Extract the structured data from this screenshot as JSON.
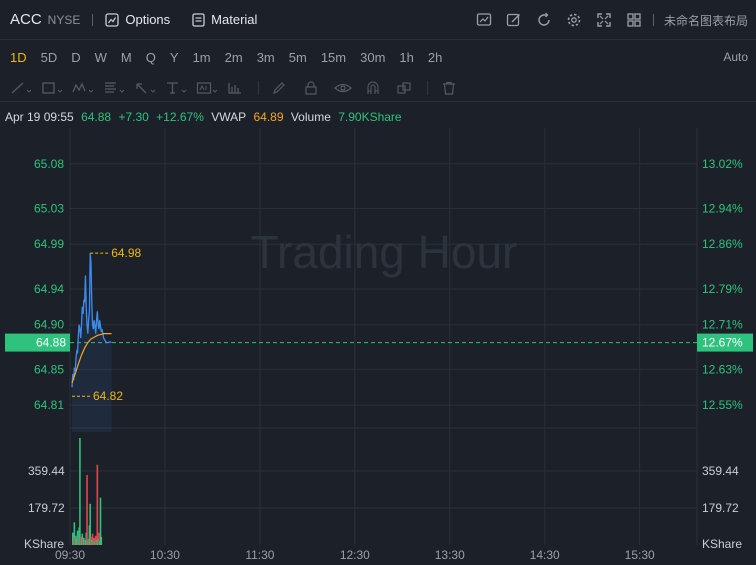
{
  "header": {
    "ticker": "ACC",
    "exchange": "NYSE",
    "options_label": "Options",
    "material_label": "Material",
    "layout_label": "未命名图表布局"
  },
  "periods": [
    "1D",
    "5D",
    "D",
    "W",
    "M",
    "Q",
    "Y",
    "1m",
    "2m",
    "3m",
    "5m",
    "15m",
    "30m",
    "1h",
    "2h"
  ],
  "active_period": "1D",
  "auto_label": "Auto",
  "info": {
    "datetime": "Apr 19 09:55",
    "price": "64.88",
    "change": "+7.30",
    "change_pct": "+12.67%",
    "vwap_label": "VWAP",
    "vwap": "64.89",
    "volume_label": "Volume",
    "volume": "7.90KShare"
  },
  "watermark": "Trading Hour",
  "colors": {
    "up": "#2ec27e",
    "down": "#e0464f",
    "price_line": "#3c8cf0",
    "vwap_line": "#f5a623",
    "accent": "#f0b90b"
  },
  "chart_data": {
    "type": "line",
    "price_axis": {
      "left_ticks": [
        "65.08",
        "65.03",
        "64.99",
        "64.94",
        "64.90",
        "64.85",
        "64.81"
      ],
      "left_values": [
        65.08,
        65.03,
        64.99,
        64.94,
        64.9,
        64.85,
        64.81
      ],
      "right_ticks": [
        "13.02%",
        "12.94%",
        "12.86%",
        "12.79%",
        "12.71%",
        "12.63%",
        "12.55%"
      ],
      "ylim": [
        64.78,
        65.12
      ]
    },
    "current_price": {
      "value": 64.88,
      "label": "64.88",
      "pct_label": "12.67%"
    },
    "high_marker": {
      "value": 64.98,
      "label": "64.98"
    },
    "low_marker": {
      "value": 64.82,
      "label": "64.82"
    },
    "time_ticks": [
      "09:30",
      "10:30",
      "11:30",
      "12:30",
      "13:30",
      "14:30",
      "15:30"
    ],
    "session_minutes": [
      0,
      390
    ],
    "price_series": [
      [
        0,
        64.83
      ],
      [
        0.5,
        64.845
      ],
      [
        1,
        64.838
      ],
      [
        1.5,
        64.852
      ],
      [
        2,
        64.848
      ],
      [
        2.5,
        64.862
      ],
      [
        3,
        64.87
      ],
      [
        3.5,
        64.868
      ],
      [
        4,
        64.888
      ],
      [
        4.5,
        64.9
      ],
      [
        5,
        64.895
      ],
      [
        5.5,
        64.885
      ],
      [
        6,
        64.9
      ],
      [
        6.5,
        64.92
      ],
      [
        7,
        64.912
      ],
      [
        7.5,
        64.928
      ],
      [
        8,
        64.925
      ],
      [
        8.5,
        64.955
      ],
      [
        9,
        64.92
      ],
      [
        9.5,
        64.9
      ],
      [
        10,
        64.89
      ],
      [
        10.5,
        64.905
      ],
      [
        11,
        64.915
      ],
      [
        11.5,
        64.98
      ],
      [
        12,
        64.97
      ],
      [
        12.5,
        64.925
      ],
      [
        13,
        64.9
      ],
      [
        13.5,
        64.895
      ],
      [
        14,
        64.905
      ],
      [
        14.5,
        64.898
      ],
      [
        15,
        64.89
      ],
      [
        15.5,
        64.905
      ],
      [
        16,
        64.915
      ],
      [
        16.5,
        64.9
      ],
      [
        17,
        64.895
      ],
      [
        17.5,
        64.905
      ],
      [
        18,
        64.898
      ],
      [
        18.5,
        64.892
      ],
      [
        19,
        64.895
      ],
      [
        19.5,
        64.89
      ],
      [
        20,
        64.885
      ],
      [
        21,
        64.882
      ],
      [
        22,
        64.88
      ],
      [
        23,
        64.88
      ],
      [
        24,
        64.881
      ],
      [
        25,
        64.88
      ]
    ],
    "vwap_series": [
      [
        0,
        64.835
      ],
      [
        2,
        64.845
      ],
      [
        4,
        64.856
      ],
      [
        6,
        64.866
      ],
      [
        8,
        64.874
      ],
      [
        10,
        64.88
      ],
      [
        12,
        64.884
      ],
      [
        14,
        64.886
      ],
      [
        16,
        64.888
      ],
      [
        18,
        64.889
      ],
      [
        20,
        64.89
      ],
      [
        22,
        64.89
      ],
      [
        25,
        64.89
      ]
    ],
    "volume_axis": {
      "ticks": [
        "359.44",
        "179.72"
      ],
      "tick_values": [
        359.44,
        179.72
      ],
      "unit": "KShare",
      "ylim": [
        0,
        520
      ]
    },
    "volume_bars": [
      {
        "t": 0,
        "v": 60,
        "dir": "up"
      },
      {
        "t": 0.5,
        "v": 25,
        "dir": "down"
      },
      {
        "t": 1,
        "v": 110,
        "dir": "up"
      },
      {
        "t": 1.5,
        "v": 35,
        "dir": "down"
      },
      {
        "t": 2,
        "v": 45,
        "dir": "up"
      },
      {
        "t": 2.5,
        "v": 30,
        "dir": "up"
      },
      {
        "t": 3,
        "v": 70,
        "dir": "up"
      },
      {
        "t": 3.5,
        "v": 40,
        "dir": "down"
      },
      {
        "t": 4,
        "v": 85,
        "dir": "up"
      },
      {
        "t": 4.5,
        "v": 520,
        "dir": "up"
      },
      {
        "t": 5,
        "v": 40,
        "dir": "down"
      },
      {
        "t": 5.5,
        "v": 20,
        "dir": "up"
      },
      {
        "t": 6,
        "v": 55,
        "dir": "up"
      },
      {
        "t": 6.5,
        "v": 28,
        "dir": "down"
      },
      {
        "t": 7,
        "v": 35,
        "dir": "up"
      },
      {
        "t": 7.5,
        "v": 18,
        "dir": "down"
      },
      {
        "t": 8,
        "v": 25,
        "dir": "up"
      },
      {
        "t": 8.5,
        "v": 60,
        "dir": "up"
      },
      {
        "t": 9,
        "v": 340,
        "dir": "down"
      },
      {
        "t": 9.5,
        "v": 22,
        "dir": "up"
      },
      {
        "t": 10,
        "v": 30,
        "dir": "down"
      },
      {
        "t": 10.5,
        "v": 95,
        "dir": "up"
      },
      {
        "t": 11,
        "v": 200,
        "dir": "up"
      },
      {
        "t": 11.5,
        "v": 40,
        "dir": "down"
      },
      {
        "t": 12,
        "v": 25,
        "dir": "up"
      },
      {
        "t": 12.5,
        "v": 55,
        "dir": "down"
      },
      {
        "t": 13,
        "v": 30,
        "dir": "up"
      },
      {
        "t": 13.5,
        "v": 35,
        "dir": "down"
      },
      {
        "t": 14,
        "v": 20,
        "dir": "up"
      },
      {
        "t": 14.5,
        "v": 45,
        "dir": "down"
      },
      {
        "t": 15,
        "v": 25,
        "dir": "up"
      },
      {
        "t": 15.5,
        "v": 390,
        "dir": "down"
      },
      {
        "t": 16,
        "v": 30,
        "dir": "up"
      },
      {
        "t": 16.5,
        "v": 60,
        "dir": "down"
      },
      {
        "t": 17,
        "v": 20,
        "dir": "up"
      },
      {
        "t": 17.5,
        "v": 230,
        "dir": "up"
      },
      {
        "t": 18,
        "v": 40,
        "dir": "up"
      }
    ]
  }
}
